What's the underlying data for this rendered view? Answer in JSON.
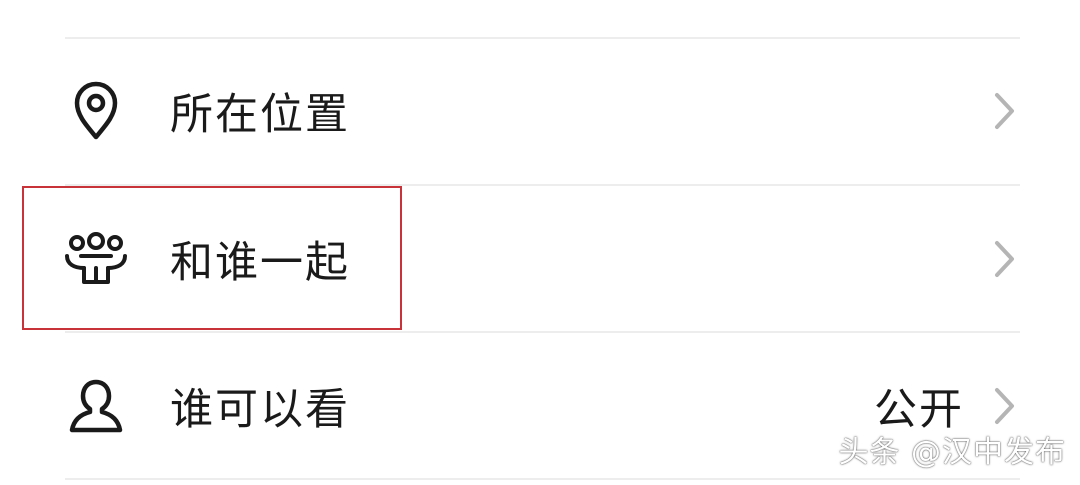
{
  "settings_list": {
    "items": [
      {
        "label": "所在位置",
        "value": "",
        "icon": "location-pin-icon"
      },
      {
        "label": "和谁一起",
        "value": "",
        "icon": "group-people-icon"
      },
      {
        "label": "谁可以看",
        "value": "公开",
        "icon": "person-outline-icon"
      }
    ]
  },
  "chevron_icon": "chevron-right-icon",
  "highlight_color": "#c8333a",
  "watermark": {
    "text": "头条 @汉中发布"
  }
}
